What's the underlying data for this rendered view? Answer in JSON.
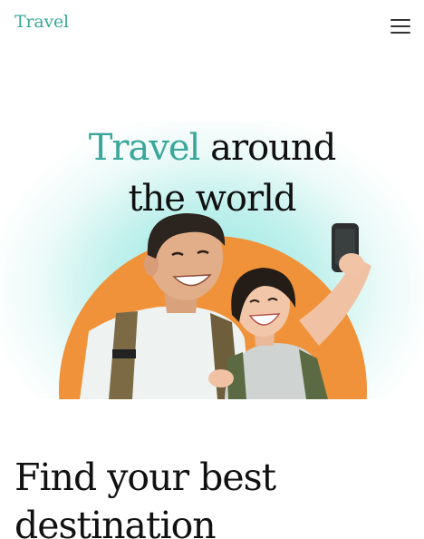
{
  "theme": {
    "accent": "#3aa79a",
    "hero_circle": "#f0923a"
  },
  "header": {
    "brand": "Travel",
    "menu_icon": "hamburger-menu-icon"
  },
  "hero": {
    "title_highlight": "Travel",
    "title_rest_line1": " around",
    "title_line2": "the world",
    "image": "couple-taking-selfie-illustration"
  },
  "section": {
    "title": "Find your best destination"
  }
}
